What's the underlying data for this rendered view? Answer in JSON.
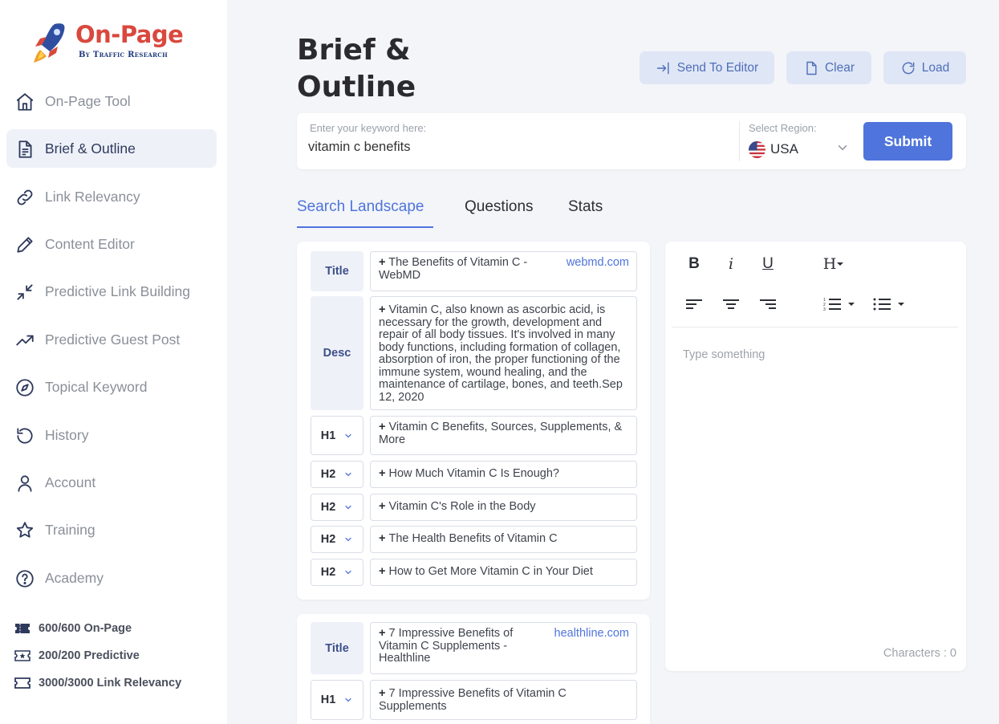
{
  "brand": {
    "title": "On-Page",
    "subtitle": "By Traffic Research"
  },
  "sidebar": {
    "items": [
      {
        "label": "On-Page Tool",
        "icon": "home-icon"
      },
      {
        "label": "Brief & Outline",
        "icon": "document-icon",
        "active": true
      },
      {
        "label": "Link Relevancy",
        "icon": "link-icon"
      },
      {
        "label": "Content Editor",
        "icon": "pencil-icon"
      },
      {
        "label": "Predictive Link Building",
        "icon": "collapse-arrows-icon"
      },
      {
        "label": "Predictive Guest Post",
        "icon": "trending-up-icon"
      },
      {
        "label": "Topical Keyword",
        "icon": "compass-icon"
      },
      {
        "label": "History",
        "icon": "history-icon"
      },
      {
        "label": "Account",
        "icon": "user-icon"
      },
      {
        "label": "Training",
        "icon": "star-icon"
      },
      {
        "label": "Academy",
        "icon": "help-circle-icon"
      }
    ],
    "credits": [
      {
        "label": "600/600 On-Page"
      },
      {
        "label": "200/200 Predictive"
      },
      {
        "label": "3000/3000 Link Relevancy"
      }
    ]
  },
  "header": {
    "title": "Brief & Outline",
    "buttons": {
      "send": "Send To Editor",
      "clear": "Clear",
      "load": "Load"
    }
  },
  "search": {
    "label": "Enter your keyword here:",
    "value": "vitamin c benefits",
    "region_label": "Select Region:",
    "region_value": "USA",
    "submit": "Submit"
  },
  "tabs": {
    "landscape": "Search Landscape",
    "questions": "Questions",
    "stats": "Stats"
  },
  "results": [
    {
      "domain": "webmd.com",
      "title_tag": "Title",
      "title": "The Benefits of Vitamin C - WebMD",
      "desc_tag": "Desc",
      "desc": "Vitamin C, also known as ascorbic acid, is necessary for the growth, development and repair of all body tissues. It's involved in many body functions, including formation of collagen, absorption of iron, the proper functioning of the immune system, wound healing, and the maintenance of cartilage, bones, and teeth.Sep 12, 2020",
      "headings": [
        {
          "level": "H1",
          "text": "Vitamin C Benefits, Sources, Supplements, & More"
        },
        {
          "level": "H2",
          "text": "How Much Vitamin C Is Enough?"
        },
        {
          "level": "H2",
          "text": "Vitamin C's Role in the Body"
        },
        {
          "level": "H2",
          "text": "The Health Benefits of Vitamin C"
        },
        {
          "level": "H2",
          "text": "How to Get More Vitamin C in Your Diet"
        }
      ]
    },
    {
      "domain": "healthline.com",
      "title_tag": "Title",
      "title": "7 Impressive Benefits of Vitamin C Supplements - Healthline",
      "headings": [
        {
          "level": "H1",
          "text": "7 Impressive Benefits of Vitamin C Supplements"
        }
      ]
    }
  ],
  "plus": "+",
  "editor": {
    "placeholder": "Type something",
    "count_label": "Characters : 0",
    "bold": "B",
    "italic": "i",
    "underline": "U",
    "heading": "H"
  }
}
